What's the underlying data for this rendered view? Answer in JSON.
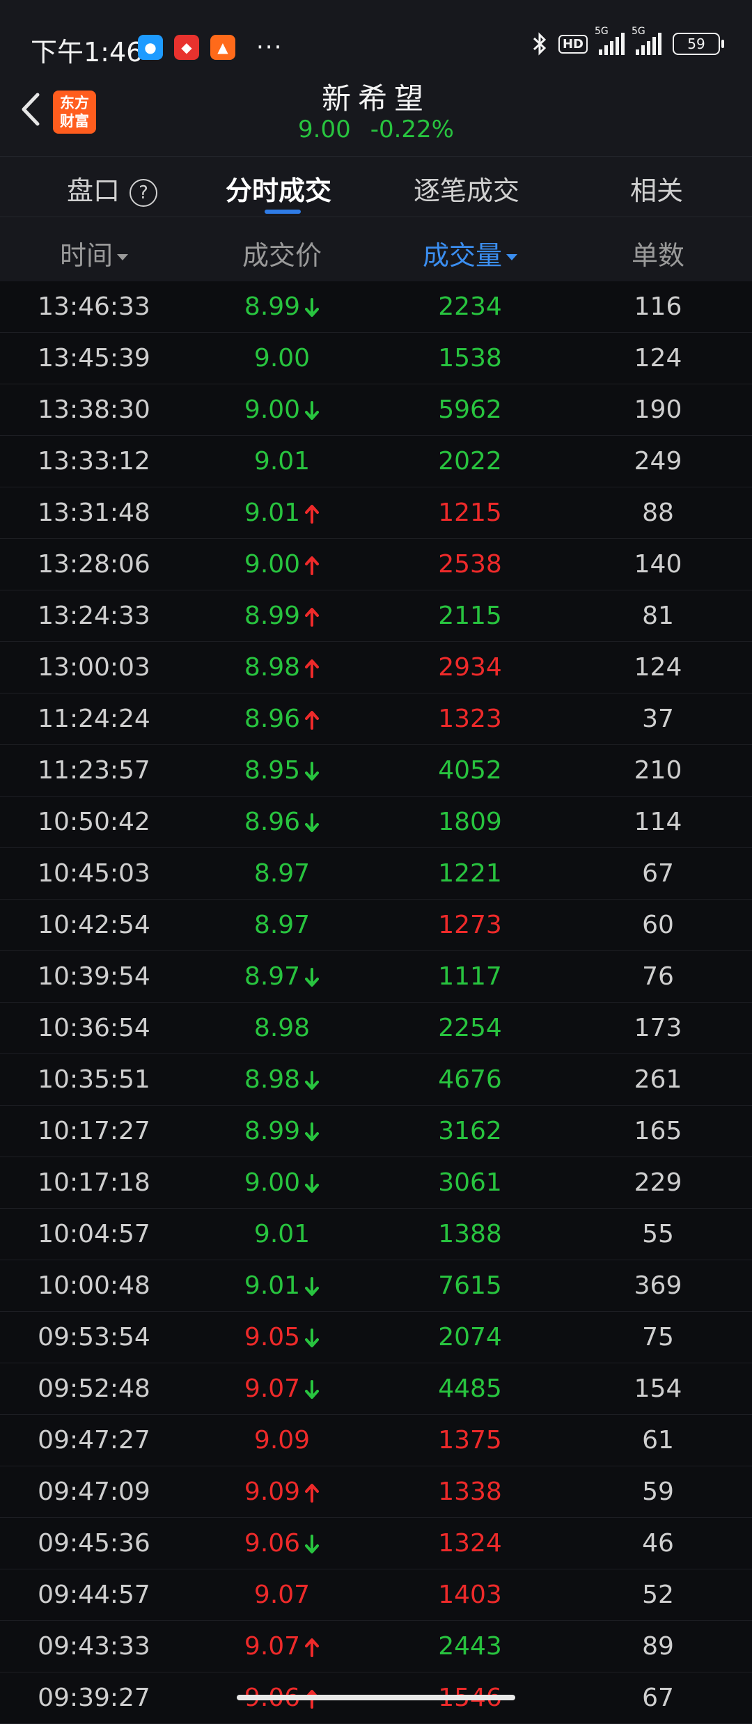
{
  "status": {
    "time": "下午1:46",
    "battery": "59",
    "hd": "HD",
    "net1": "5G",
    "net2": "5G",
    "more": "···"
  },
  "header": {
    "logo": "东方财富",
    "stock_name": "新希望",
    "price": "9.00",
    "change": "-0.22%"
  },
  "tabs": [
    {
      "label": "盘口"
    },
    {
      "label": "分时成交",
      "active": true
    },
    {
      "label": "逐笔成交"
    },
    {
      "label": "相关"
    }
  ],
  "columns": {
    "time": "时间",
    "price": "成交价",
    "volume": "成交量",
    "count": "单数"
  },
  "colors": {
    "up": "#ee2a2a",
    "down": "#28c43f",
    "accent": "#3b8ef0",
    "background": "#0c0d10"
  },
  "rows": [
    {
      "time": "13:46:33",
      "price": "8.99",
      "price_color": "green",
      "arrow": "down",
      "volume": "2234",
      "volume_color": "green",
      "count": "116"
    },
    {
      "time": "13:45:39",
      "price": "9.00",
      "price_color": "green",
      "arrow": "",
      "volume": "1538",
      "volume_color": "green",
      "count": "124"
    },
    {
      "time": "13:38:30",
      "price": "9.00",
      "price_color": "green",
      "arrow": "down",
      "volume": "5962",
      "volume_color": "green",
      "count": "190"
    },
    {
      "time": "13:33:12",
      "price": "9.01",
      "price_color": "green",
      "arrow": "",
      "volume": "2022",
      "volume_color": "green",
      "count": "249"
    },
    {
      "time": "13:31:48",
      "price": "9.01",
      "price_color": "green",
      "arrow": "up",
      "volume": "1215",
      "volume_color": "red",
      "count": "88"
    },
    {
      "time": "13:28:06",
      "price": "9.00",
      "price_color": "green",
      "arrow": "up",
      "volume": "2538",
      "volume_color": "red",
      "count": "140"
    },
    {
      "time": "13:24:33",
      "price": "8.99",
      "price_color": "green",
      "arrow": "up",
      "volume": "2115",
      "volume_color": "green",
      "count": "81"
    },
    {
      "time": "13:00:03",
      "price": "8.98",
      "price_color": "green",
      "arrow": "up",
      "volume": "2934",
      "volume_color": "red",
      "count": "124"
    },
    {
      "time": "11:24:24",
      "price": "8.96",
      "price_color": "green",
      "arrow": "up",
      "volume": "1323",
      "volume_color": "red",
      "count": "37"
    },
    {
      "time": "11:23:57",
      "price": "8.95",
      "price_color": "green",
      "arrow": "down",
      "volume": "4052",
      "volume_color": "green",
      "count": "210"
    },
    {
      "time": "10:50:42",
      "price": "8.96",
      "price_color": "green",
      "arrow": "down",
      "volume": "1809",
      "volume_color": "green",
      "count": "114"
    },
    {
      "time": "10:45:03",
      "price": "8.97",
      "price_color": "green",
      "arrow": "",
      "volume": "1221",
      "volume_color": "green",
      "count": "67"
    },
    {
      "time": "10:42:54",
      "price": "8.97",
      "price_color": "green",
      "arrow": "",
      "volume": "1273",
      "volume_color": "red",
      "count": "60"
    },
    {
      "time": "10:39:54",
      "price": "8.97",
      "price_color": "green",
      "arrow": "down",
      "volume": "1117",
      "volume_color": "green",
      "count": "76"
    },
    {
      "time": "10:36:54",
      "price": "8.98",
      "price_color": "green",
      "arrow": "",
      "volume": "2254",
      "volume_color": "green",
      "count": "173"
    },
    {
      "time": "10:35:51",
      "price": "8.98",
      "price_color": "green",
      "arrow": "down",
      "volume": "4676",
      "volume_color": "green",
      "count": "261"
    },
    {
      "time": "10:17:27",
      "price": "8.99",
      "price_color": "green",
      "arrow": "down",
      "volume": "3162",
      "volume_color": "green",
      "count": "165"
    },
    {
      "time": "10:17:18",
      "price": "9.00",
      "price_color": "green",
      "arrow": "down",
      "volume": "3061",
      "volume_color": "green",
      "count": "229"
    },
    {
      "time": "10:04:57",
      "price": "9.01",
      "price_color": "green",
      "arrow": "",
      "volume": "1388",
      "volume_color": "green",
      "count": "55"
    },
    {
      "time": "10:00:48",
      "price": "9.01",
      "price_color": "green",
      "arrow": "down",
      "volume": "7615",
      "volume_color": "green",
      "count": "369"
    },
    {
      "time": "09:53:54",
      "price": "9.05",
      "price_color": "red",
      "arrow": "down",
      "volume": "2074",
      "volume_color": "green",
      "count": "75"
    },
    {
      "time": "09:52:48",
      "price": "9.07",
      "price_color": "red",
      "arrow": "down",
      "volume": "4485",
      "volume_color": "green",
      "count": "154"
    },
    {
      "time": "09:47:27",
      "price": "9.09",
      "price_color": "red",
      "arrow": "",
      "volume": "1375",
      "volume_color": "red",
      "count": "61"
    },
    {
      "time": "09:47:09",
      "price": "9.09",
      "price_color": "red",
      "arrow": "up",
      "volume": "1338",
      "volume_color": "red",
      "count": "59"
    },
    {
      "time": "09:45:36",
      "price": "9.06",
      "price_color": "red",
      "arrow": "down",
      "volume": "1324",
      "volume_color": "red",
      "count": "46"
    },
    {
      "time": "09:44:57",
      "price": "9.07",
      "price_color": "red",
      "arrow": "",
      "volume": "1403",
      "volume_color": "red",
      "count": "52"
    },
    {
      "time": "09:43:33",
      "price": "9.07",
      "price_color": "red",
      "arrow": "up",
      "volume": "2443",
      "volume_color": "green",
      "count": "89"
    },
    {
      "time": "09:39:27",
      "price": "9.06",
      "price_color": "red",
      "arrow": "up",
      "volume": "1546",
      "volume_color": "red",
      "count": "67"
    }
  ]
}
